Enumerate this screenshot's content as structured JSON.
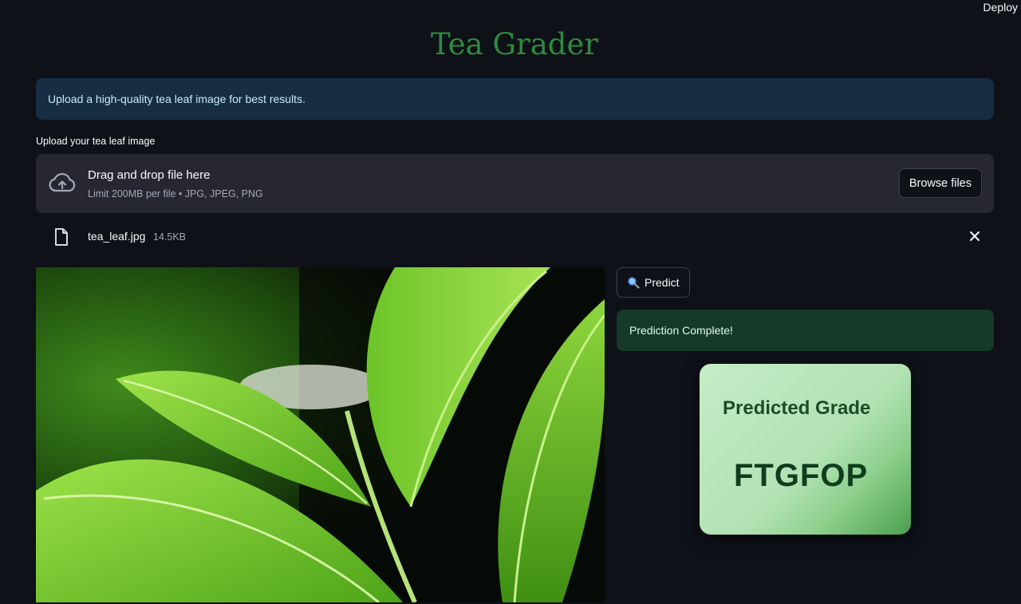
{
  "header": {
    "deploy_label": "Deploy"
  },
  "page": {
    "title": "Tea Grader"
  },
  "info": {
    "message": "Upload a high-quality tea leaf image for best results."
  },
  "uploader": {
    "label": "Upload your tea leaf image",
    "drop_title": "Drag and drop file here",
    "drop_hint": "Limit 200MB per file • JPG, JPEG, PNG",
    "browse_label": "Browse files",
    "file": {
      "name": "tea_leaf.jpg",
      "size": "14.5KB"
    }
  },
  "actions": {
    "predict_label": "Predict"
  },
  "result": {
    "status": "Prediction Complete!",
    "card_label": "Predicted Grade",
    "grade": "FTGFOP"
  },
  "colors": {
    "background": "#0e1117",
    "title": "#2e8b3e",
    "info_bg": "#172d43",
    "success_bg": "#173928",
    "card_light": "#c5ecc6",
    "card_dark": "#4a9e4d"
  }
}
